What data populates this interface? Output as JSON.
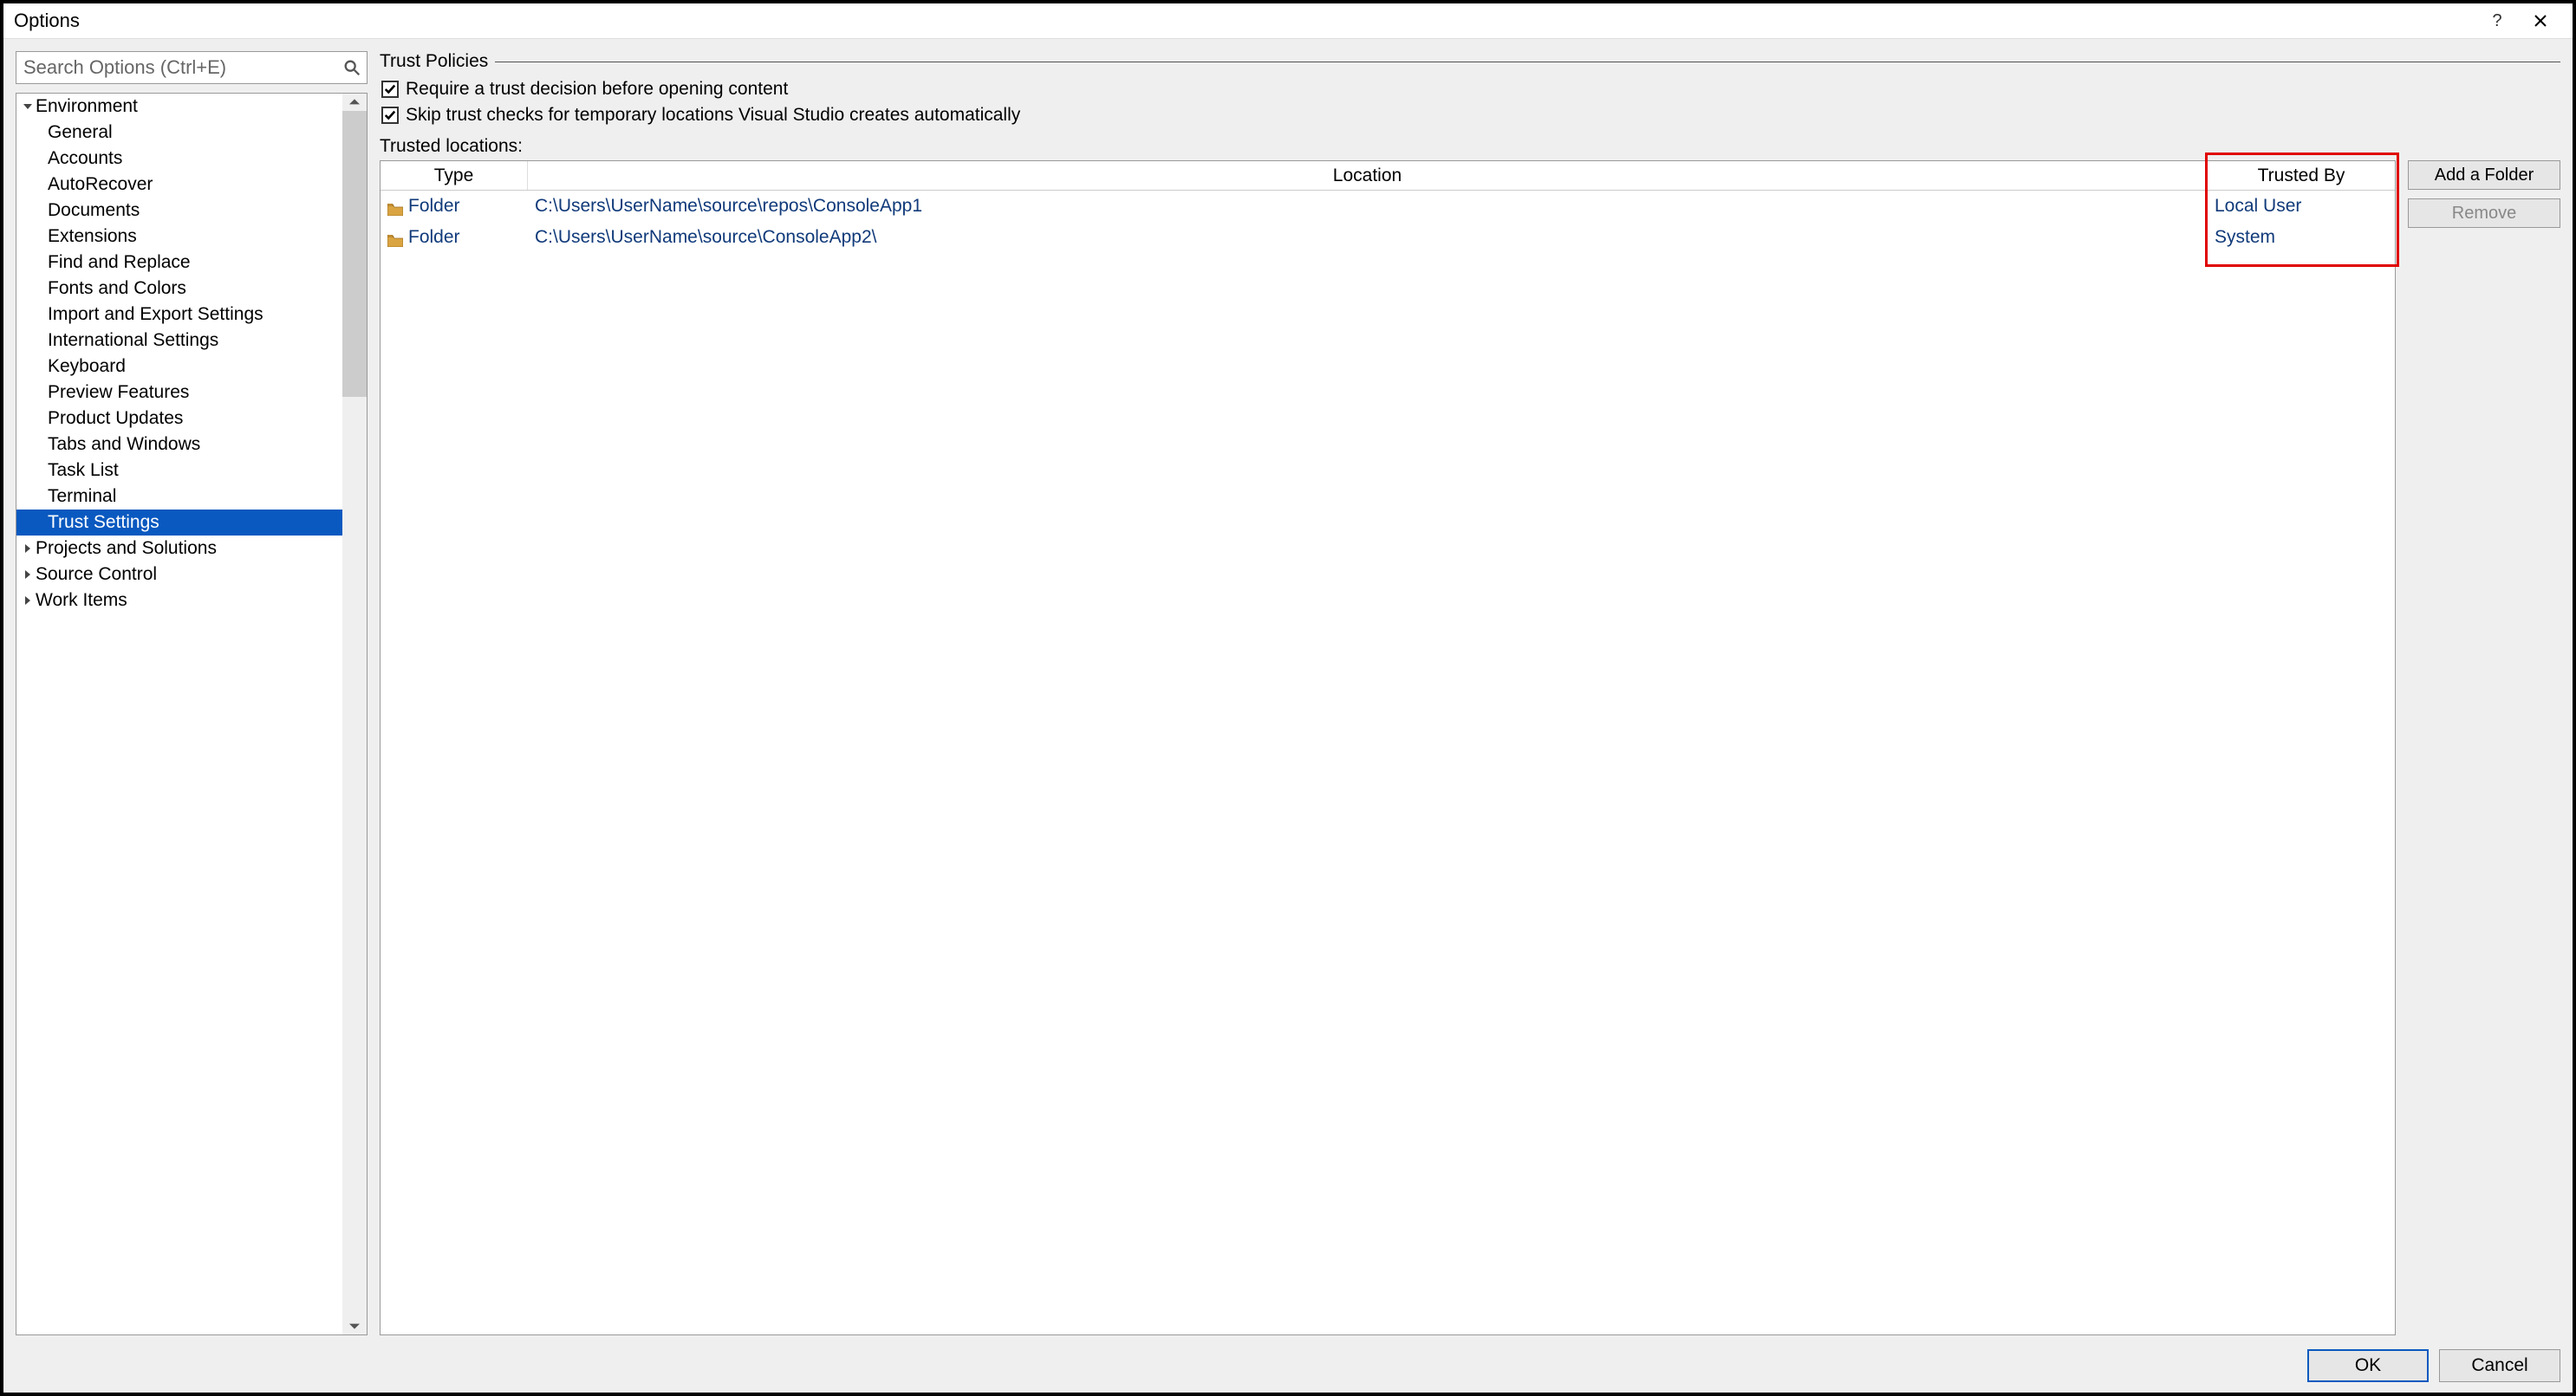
{
  "window": {
    "title": "Options"
  },
  "search": {
    "placeholder": "Search Options (Ctrl+E)"
  },
  "tree": {
    "root": "Environment",
    "children": [
      "General",
      "Accounts",
      "AutoRecover",
      "Documents",
      "Extensions",
      "Find and Replace",
      "Fonts and Colors",
      "Import and Export Settings",
      "International Settings",
      "Keyboard",
      "Preview Features",
      "Product Updates",
      "Tabs and Windows",
      "Task List",
      "Terminal",
      "Trust Settings"
    ],
    "selected": "Trust Settings",
    "siblings": [
      "Projects and Solutions",
      "Source Control",
      "Work Items"
    ]
  },
  "panel": {
    "group_title": "Trust Policies",
    "chk1": "Require a trust decision before opening content",
    "chk2": "Skip trust checks for temporary locations Visual Studio creates automatically",
    "locations_label": "Trusted locations:",
    "columns": {
      "type": "Type",
      "location": "Location",
      "trusted_by": "Trusted By"
    },
    "rows": [
      {
        "type": "Folder",
        "location": "C:\\Users\\UserName\\source\\repos\\ConsoleApp1",
        "trusted_by": "Local User"
      },
      {
        "type": "Folder",
        "location": "C:\\Users\\UserName\\source\\ConsoleApp2\\",
        "trusted_by": "System"
      }
    ],
    "add_btn": "Add a Folder",
    "remove_btn": "Remove"
  },
  "footer": {
    "ok": "OK",
    "cancel": "Cancel"
  }
}
